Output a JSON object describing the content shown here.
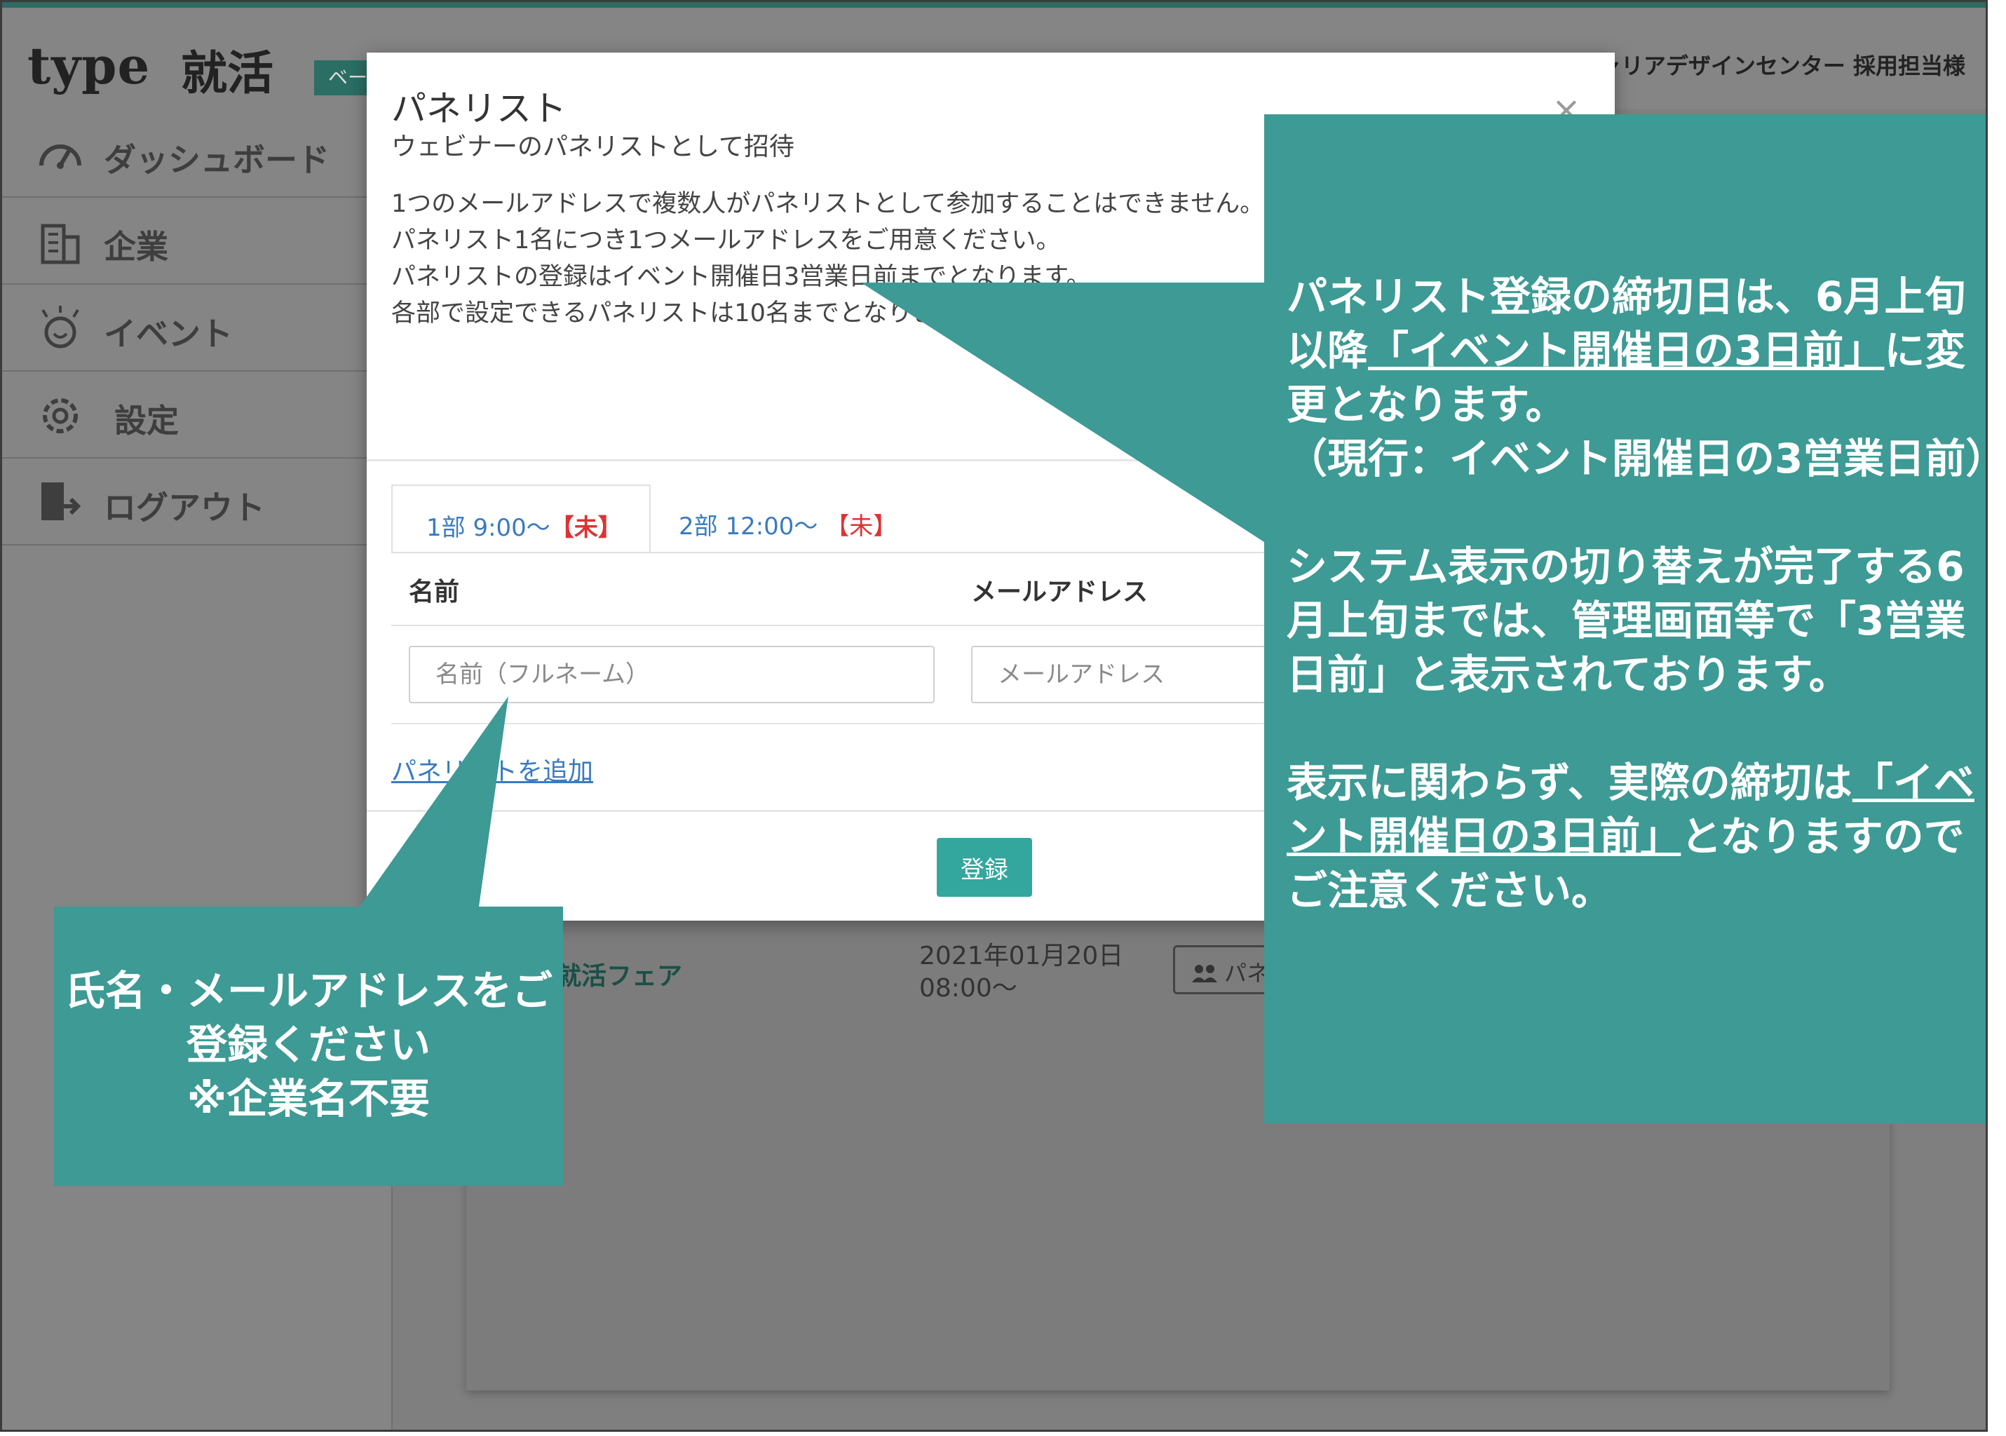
{
  "header": {
    "logo_text": "type",
    "logo_ja": "就活",
    "badge": "ベー",
    "user_label": "キャリアデザインセンター 採用担当様"
  },
  "sidebar": {
    "items": [
      {
        "label": "ダッシュボード",
        "icon": "dashboard-icon"
      },
      {
        "label": "企業",
        "icon": "building-icon"
      },
      {
        "label": "イベント",
        "icon": "event-icon"
      },
      {
        "label": "設定",
        "icon": "gear-icon"
      },
      {
        "label": "ログアウト",
        "icon": "logout-icon"
      }
    ]
  },
  "background": {
    "fair_name": "就活フェア",
    "date_line1": "2021年01月20日",
    "date_line2": "08:00〜",
    "panel_button": "パネ"
  },
  "modal": {
    "title": "パネリスト",
    "subtitle": "ウェビナーのパネリストとして招待",
    "close": "×",
    "notes": [
      "1つのメールアドレスで複数人がパネリストとして参加することはできません。",
      "パネリスト1名につき1つメールアドレスをご用意ください。",
      "パネリストの登録はイベント開催日3営業日前までとなります。",
      "各部で設定できるパネリストは10名までとなります。"
    ],
    "tabs": [
      {
        "label": "1部 9:00〜",
        "status": "【未】"
      },
      {
        "label": "2部 12:00〜",
        "status": "【未】"
      }
    ],
    "col_name": "名前",
    "col_email": "メールアドレス",
    "name_placeholder": "名前（フルネーム）",
    "email_placeholder": "メールアドレス",
    "add_link": "パネリストを追加",
    "submit": "登録"
  },
  "annotations": {
    "right": {
      "p1_a": "パネリスト登録の締切日は、6月上旬以降",
      "p1_u": "「イベント開催日の3日前」",
      "p1_b": "に変更となります。",
      "p2": "（現行：イベント開催日の3営業日前）",
      "p3": "システム表示の切り替えが完了する6月上旬までは、管理画面等で「3営業日前」と表示されております。",
      "p4_a": "表示に関わらず、実際の締切は",
      "p4_u": "「イベント開催日の3日前」",
      "p4_b": "となりますのでご注意ください。"
    },
    "left": {
      "line1": "氏名・メールアドレスをご",
      "line2": "登録ください",
      "line3": "※企業名不要"
    }
  },
  "colors": {
    "teal": "#3d9a94",
    "button_teal": "#33a79d",
    "link_blue": "#3a7bbf",
    "unset_red": "#dd3333"
  }
}
